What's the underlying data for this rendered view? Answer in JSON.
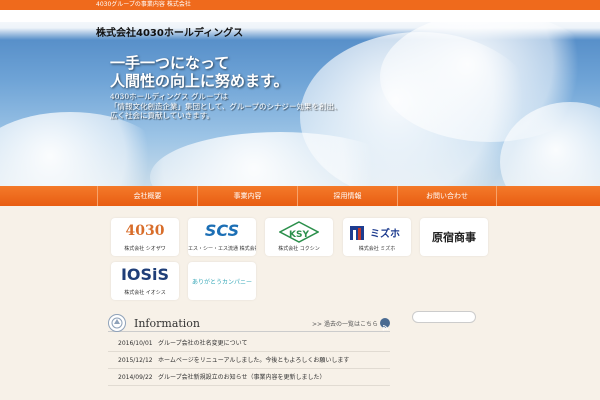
{
  "topbar": {
    "tagline": "4030グループの事業内容 株式会社"
  },
  "header": {
    "logo_text": "株式会社4030ホールディングス"
  },
  "hero": {
    "headline_1": "一手一つになって",
    "headline_2": "人間性の向上に努めます。",
    "body_1": "4030ホールディングス グループは",
    "body_2": "「情報文化創造企業」集団として、グループのシナジー効果を創出、",
    "body_3": "広く社会に貢献していきます。"
  },
  "nav": {
    "items": [
      {
        "label": "会社概要"
      },
      {
        "label": "事業内容"
      },
      {
        "label": "採用情報"
      },
      {
        "label": "お問い合わせ"
      }
    ]
  },
  "companies": [
    {
      "mark": "4030",
      "caption": "株式会社 シオザワ",
      "color": "#d86d2a"
    },
    {
      "mark": "SCS",
      "caption": "エス・シー・エス流通 株式会社",
      "color": "#1c6fb5"
    },
    {
      "mark": "KSY",
      "caption": "株式会社 コクシン",
      "color": "#2b8f4b"
    },
    {
      "mark": "ミズホ",
      "caption": "株式会社 ミズホ",
      "color": "#1e3c8f"
    },
    {
      "mark": "原宿商事",
      "caption": "",
      "color": "#222222"
    },
    {
      "mark": "IOSiS",
      "caption": "株式会社 イオシス",
      "color": "#1f3e78"
    },
    {
      "mark": "",
      "caption": "ありがとうカンパニー",
      "color": "#3aa9b9"
    }
  ],
  "info": {
    "title": "Information",
    "more_link": ">> 過去の一覧はこちら",
    "items": [
      {
        "date": "2016/10/01",
        "title": "グループ会社の社名変更について"
      },
      {
        "date": "2015/12/12",
        "title": "ホームページをリニューアルしました。今後ともよろしくお願いします"
      },
      {
        "date": "2014/09/22",
        "title": "グループ会社新規設立のお知らせ（事業内容を更新しました）"
      }
    ]
  },
  "colors": {
    "accent": "#ef6a1c",
    "sky": "#6ea3d6",
    "background": "#f7f1e8"
  }
}
